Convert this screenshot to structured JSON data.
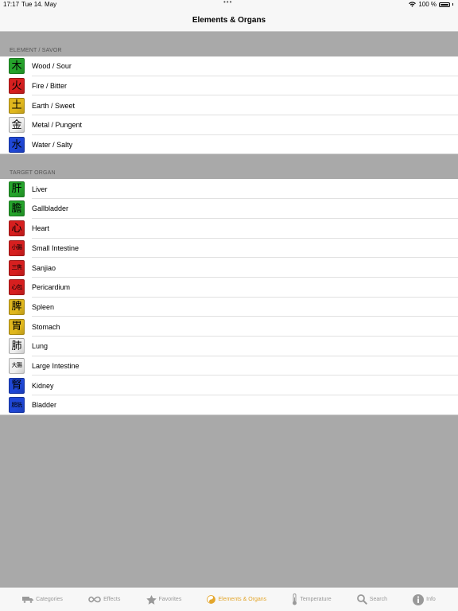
{
  "status": {
    "time": "17:17",
    "date": "Tue 14. May",
    "battery": "100 %"
  },
  "title": "Elements & Organs",
  "colors": {
    "green": "#25a32b",
    "red": "#d61f1f",
    "yellow": "#e0b71d",
    "white": "#efefef",
    "blue": "#1f47d6",
    "active_tab": "#e3a62c"
  },
  "sections": [
    {
      "header": "ELEMENT / SAVOR",
      "items": [
        {
          "label": "Wood / Sour",
          "glyph": "木",
          "color": "green"
        },
        {
          "label": "Fire / Bitter",
          "glyph": "火",
          "color": "red"
        },
        {
          "label": "Earth / Sweet",
          "glyph": "土",
          "color": "yellow"
        },
        {
          "label": "Metal / Pungent",
          "glyph": "金",
          "color": "white"
        },
        {
          "label": "Water / Salty",
          "glyph": "水",
          "color": "blue"
        }
      ]
    },
    {
      "header": "TARGET ORGAN",
      "items": [
        {
          "label": "Liver",
          "glyph": "肝",
          "color": "green"
        },
        {
          "label": "Gallbladder",
          "glyph": "膽",
          "color": "green"
        },
        {
          "label": "Heart",
          "glyph": "心",
          "color": "red"
        },
        {
          "label": "Small Intestine",
          "glyph": "小腸",
          "color": "red"
        },
        {
          "label": "Sanjiao",
          "glyph": "三焦",
          "color": "red"
        },
        {
          "label": "Pericardium",
          "glyph": "心包",
          "color": "red"
        },
        {
          "label": "Spleen",
          "glyph": "脾",
          "color": "yellow"
        },
        {
          "label": "Stomach",
          "glyph": "胃",
          "color": "yellow"
        },
        {
          "label": "Lung",
          "glyph": "肺",
          "color": "white"
        },
        {
          "label": "Large Intestine",
          "glyph": "大腸",
          "color": "white"
        },
        {
          "label": "Kidney",
          "glyph": "腎",
          "color": "blue"
        },
        {
          "label": "Bladder",
          "glyph": "膀胱",
          "color": "blue"
        }
      ]
    }
  ],
  "tabs": [
    {
      "label": "Categories",
      "icon": "truck-icon",
      "active": false
    },
    {
      "label": "Effects",
      "icon": "infinity-icon",
      "active": false
    },
    {
      "label": "Favorites",
      "icon": "star-icon",
      "active": false
    },
    {
      "label": "Elements & Organs",
      "icon": "yin-yang-icon",
      "active": true
    },
    {
      "label": "Temperature",
      "icon": "thermometer-icon",
      "active": false
    },
    {
      "label": "Search",
      "icon": "search-icon",
      "active": false
    },
    {
      "label": "Info",
      "icon": "info-icon",
      "active": false
    }
  ]
}
